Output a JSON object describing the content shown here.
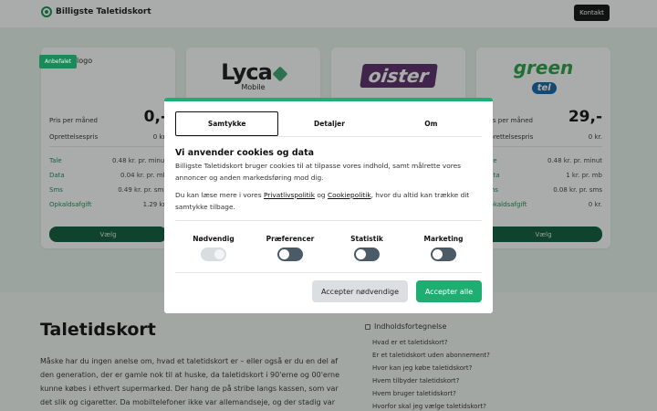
{
  "header": {
    "brand": "Billigste Taletidskort",
    "contact": "Kontakt"
  },
  "cards": [
    {
      "badge": "Anbefalet",
      "logo_text": "logo",
      "price_label": "Pris per måned",
      "price": "0,-",
      "fee_label": "Oprettelsespris",
      "fee": "0 kr.",
      "rates": [
        {
          "k": "Tale",
          "v": "0.48 kr. pr. minut"
        },
        {
          "k": "Data",
          "v": "0.04 kr. pr. mb"
        },
        {
          "k": "Sms",
          "v": "0.49 kr. pr. sms"
        },
        {
          "k": "Opkaldsafgift",
          "v": "1.29 kr."
        }
      ],
      "button": "Vælg"
    },
    {
      "logo_word": "Lyca",
      "logo_sub": "Mobile"
    },
    {
      "logo_word": "oister"
    },
    {
      "logo_word": "green",
      "logo_sub": "tel",
      "price_label": "Pris per måned",
      "price": "29,-",
      "fee_label": "Oprettelsespris",
      "fee": "0 kr.",
      "rates": [
        {
          "k": "Tale",
          "v": "0.48 kr. pr. minut"
        },
        {
          "k": "Data",
          "v": "1 kr. pr. mb"
        },
        {
          "k": "Sms",
          "v": "0.08 kr. pr. sms"
        },
        {
          "k": "Opkaldsafgift",
          "v": "0 kr."
        }
      ],
      "button": "Vælg"
    }
  ],
  "article": {
    "title": "Taletidskort",
    "body": "Måske har du ingen anelse om, hvad et taletidskort er – eller også er du en del af den generation, der er gamle nok til at huske, da taletidskort i 90'erne og 00'erne kunne købes i ethvert supermarked. Der hang de på stribe langs kassen, som var det slik og cigaretter. Da mobiltelefoner ikke var allemandseje, og der stadig var"
  },
  "toc": {
    "title": "Indholdsfortegnelse",
    "items": [
      "Hvad er et taletidskort?",
      "Er et taletidskort uden abonnement?",
      "Hvor kan jeg købe taletidskort?",
      "Hvem tilbyder taletidskort?",
      "Hvem bruger taletidskort?",
      "Hvorfor skal jeg vælge taletidskort?"
    ]
  },
  "cookie": {
    "tabs": [
      "Samtykke",
      "Detaljer",
      "Om"
    ],
    "heading": "Vi anvender cookies og data",
    "p1": "Billigste Taletidskort bruger cookies til at tilpasse vores indhold, samt målrette vores annoncer og anden markedsføring mod dig.",
    "p2_pre": "Du kan læse mere i vores ",
    "p2_link1": "Privatlivspolitik",
    "p2_mid": " og ",
    "p2_link2": "Cookiepolitik",
    "p2_post": ", hvor du altid kan trække dit samtykke tilbage.",
    "toggles": [
      {
        "label": "Nødvendig",
        "on": true,
        "disabled": true
      },
      {
        "label": "Præferencer",
        "on": false,
        "disabled": false
      },
      {
        "label": "Statistik",
        "on": false,
        "disabled": false
      },
      {
        "label": "Marketing",
        "on": false,
        "disabled": false
      }
    ],
    "btn_necessary": "Accepter nødvendige",
    "btn_all": "Accepter alle"
  },
  "colors": {
    "accent": "#1fae72",
    "dark_button": "#0f5b3a",
    "toggle_off": "#4a5a66"
  }
}
